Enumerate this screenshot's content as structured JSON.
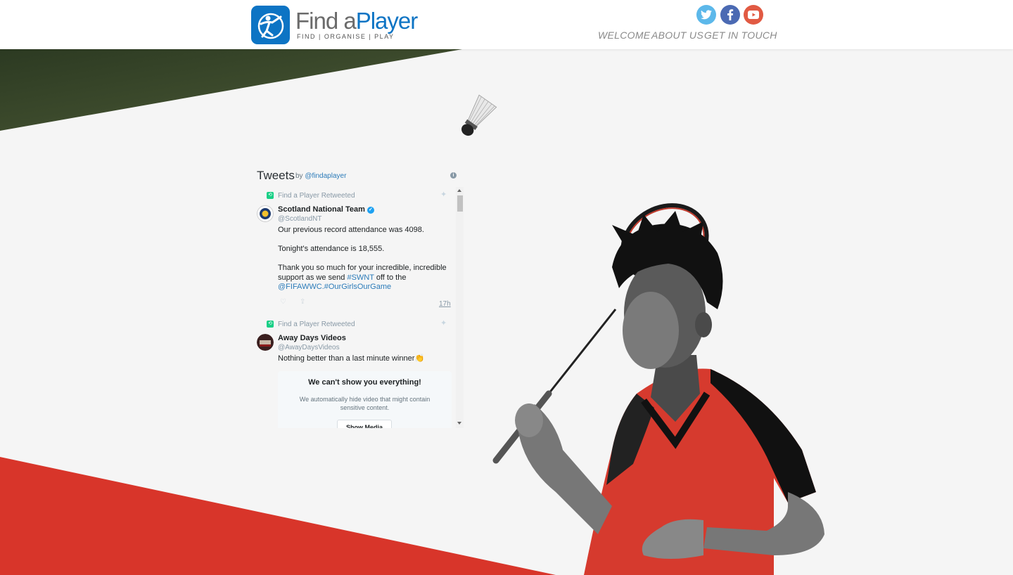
{
  "brand": {
    "title_part1": "Find a",
    "title_part2": "Player",
    "tagline": "FIND | ORGANISE | PLAY"
  },
  "social": {
    "twitter_icon": "twitter-bird-icon",
    "facebook_icon": "facebook-f-icon",
    "youtube_icon": "youtube-play-icon",
    "colors": {
      "twitter": "#5cb8ea",
      "facebook": "#4b6ab3",
      "youtube": "#e15a43"
    }
  },
  "nav": {
    "items": [
      "WELCOME",
      "ABOUT US",
      "GET IN TOUCH"
    ]
  },
  "colors": {
    "brand_blue": "#0d74c4",
    "accent_red": "#d8352a",
    "link_blue": "#2b7bb9"
  },
  "widget": {
    "title": "Tweets",
    "by_prefix": "by",
    "handle": "@findaplayer",
    "info_icon": "i"
  },
  "tweets": [
    {
      "retweet_label": "Find a Player Retweeted",
      "name": "Scotland National Team",
      "handle": "@ScotlandNT",
      "para1": "Our previous record attendance was 4098.",
      "para2": "Tonight's attendance is 18,555.",
      "para3_text": "Thank you so much for your incredible, incredible support as we send",
      "hashtag1": "#SWNT",
      "para3_mid": "off to the",
      "mention": "@FIFAWWC",
      "hashtag2": ".#OurGirlsOurGame",
      "time": "17h"
    },
    {
      "retweet_label": "Find a Player Retweeted",
      "name": "Away Days Videos",
      "handle": "@AwayDaysVideos",
      "text": "Nothing better than a last minute winner👏",
      "sensitive_title": "We can't show you everything!",
      "sensitive_desc": "We automatically hide video that might contain sensitive content.",
      "show_media": "Show Media"
    }
  ]
}
